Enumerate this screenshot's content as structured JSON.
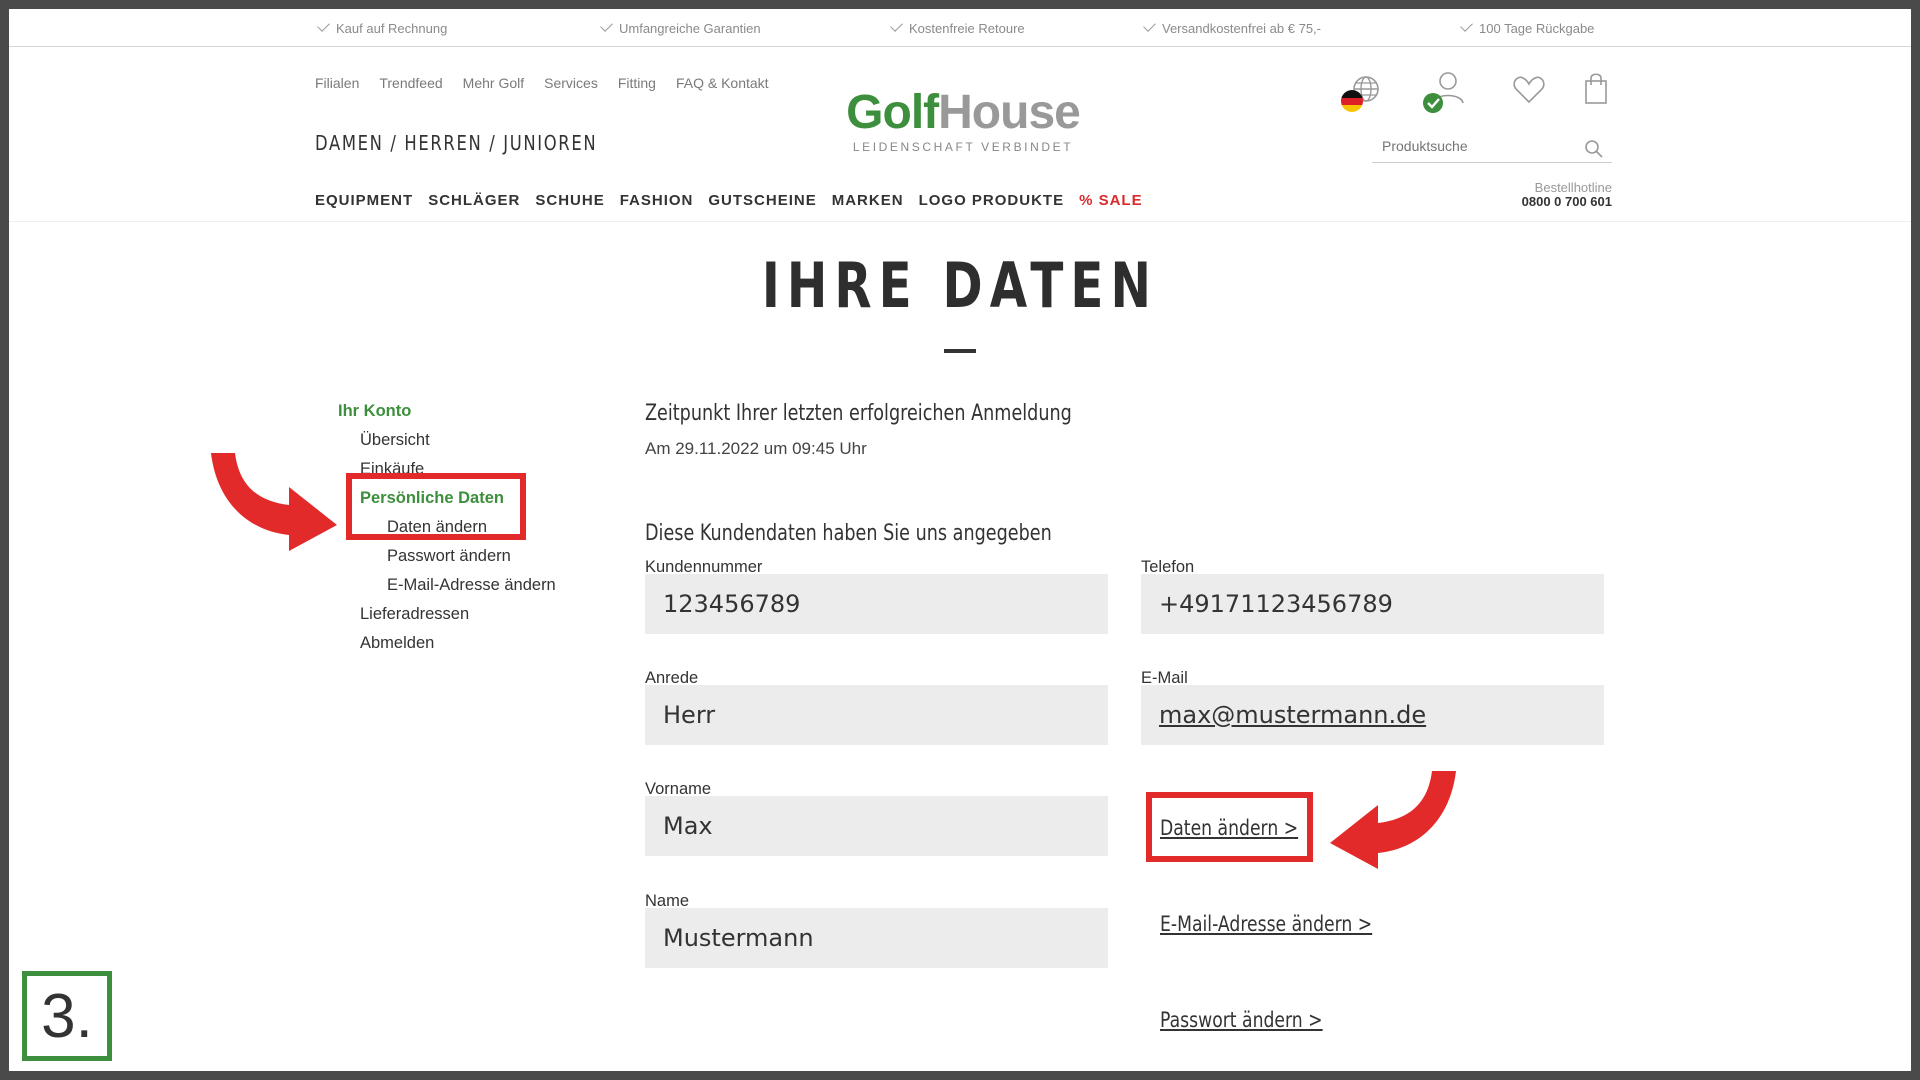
{
  "usp": [
    "Kauf auf Rechnung",
    "Umfangreiche Garantien",
    "Kostenfreie Retoure",
    "Versandkostenfrei ab € 75,-",
    "100 Tage Rückgabe"
  ],
  "topnav": [
    "Filialen",
    "Trendfeed",
    "Mehr Golf",
    "Services",
    "Fitting",
    "FAQ & Kontakt"
  ],
  "gender_nav": "DAMEN  /  HERREN  /  JUNIOREN",
  "mainnav": [
    "EQUIPMENT",
    "SCHLÄGER",
    "SCHUHE",
    "FASHION",
    "GUTSCHEINE",
    "MARKEN",
    "LOGO PRODUKTE",
    "% SALE"
  ],
  "logo": {
    "part1": "Golf",
    "part2": "House",
    "tagline": "LEIDENSCHAFT VERBINDET",
    "green": "#3d8f3d"
  },
  "header_icons": [
    "globe-icon",
    "user-icon",
    "heart-icon",
    "bag-icon",
    "search-icon"
  ],
  "search": {
    "placeholder": "Produktsuche"
  },
  "hotline": {
    "label": "Bestellhotline",
    "number": "0800 0 700 601"
  },
  "page_title": "IHRE DATEN",
  "sidebar": {
    "heading": "Ihr Konto",
    "items": [
      "Übersicht",
      "Einkäufe",
      "Persönliche Daten",
      "Daten ändern",
      "Passwort ändern",
      "E-Mail-Adresse ändern",
      "Lieferadressen",
      "Abmelden"
    ]
  },
  "last_login": {
    "heading": "Zeitpunkt Ihrer letzten erfolgreichen Anmeldung",
    "value": "Am 29.11.2022 um 09:45 Uhr"
  },
  "customer": {
    "heading": "Diese Kundendaten haben Sie uns angegeben",
    "fields": [
      {
        "label": "Kundennummer",
        "value": "123456789"
      },
      {
        "label": "Telefon",
        "value": "+49171123456789"
      },
      {
        "label": "Anrede",
        "value": "Herr"
      },
      {
        "label": "E-Mail",
        "value": "max@mustermann.de"
      },
      {
        "label": "Vorname",
        "value": "Max"
      },
      {
        "label": "Name",
        "value": "Mustermann"
      }
    ]
  },
  "links": {
    "edit_data": "Daten ändern >",
    "edit_email": "E-Mail-Adresse ändern >",
    "edit_password": "Passwort ändern >"
  },
  "step_badge": "3.",
  "colors": {
    "accent_green": "#3d8f3d",
    "highlight_red": "#e32a2a",
    "sale_red": "#d92b2b"
  }
}
